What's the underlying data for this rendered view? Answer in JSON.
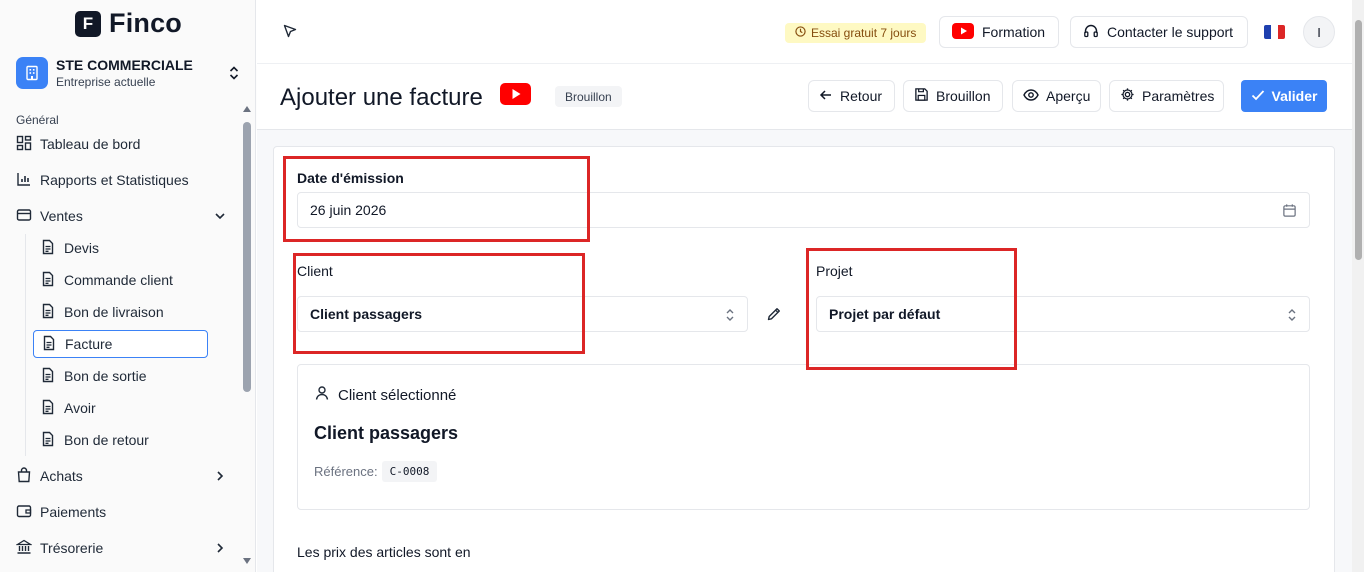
{
  "app": {
    "logo_letter": "F",
    "name": "Finco"
  },
  "company": {
    "name": "STE COMMERCIALE",
    "subtitle": "Entreprise actuelle"
  },
  "sidebar": {
    "section": "Général",
    "items": [
      {
        "label": "Tableau de bord",
        "icon": "dashboard-icon"
      },
      {
        "label": "Rapports et Statistiques",
        "icon": "bar-chart-icon"
      },
      {
        "label": "Ventes",
        "icon": "wallet-icon",
        "expanded": true
      },
      {
        "label": "Achats",
        "icon": "shopping-bag-icon"
      },
      {
        "label": "Paiements",
        "icon": "wallet-icon"
      },
      {
        "label": "Trésorerie",
        "icon": "bank-icon"
      }
    ],
    "ventes_subitems": [
      "Devis",
      "Commande client",
      "Bon de livraison",
      "Facture",
      "Bon de sortie",
      "Avoir",
      "Bon de retour"
    ],
    "active_subitem": "Facture"
  },
  "topbar": {
    "trial": "Essai gratuit 7 jours",
    "formation": "Formation",
    "support": "Contacter le support",
    "avatar_initial": "I"
  },
  "header": {
    "title": "Ajouter une facture",
    "status": "Brouillon",
    "buttons": {
      "back": "Retour",
      "draft": "Brouillon",
      "preview": "Aperçu",
      "settings": "Paramètres",
      "validate": "Valider"
    }
  },
  "form": {
    "date_label": "Date d'émission",
    "date_value": "26 juin 2026",
    "client_label": "Client",
    "client_value": "Client passagers",
    "project_label": "Projet",
    "project_value": "Projet par défaut",
    "selected_client": {
      "heading": "Client sélectionné",
      "name": "Client passagers",
      "ref_label": "Référence:",
      "ref_value": "C-0008"
    },
    "prices_text": "Les prix des articles sont en"
  },
  "colors": {
    "accent": "#3b82f6",
    "highlight": "#dc2626",
    "youtube": "#ff0000"
  }
}
